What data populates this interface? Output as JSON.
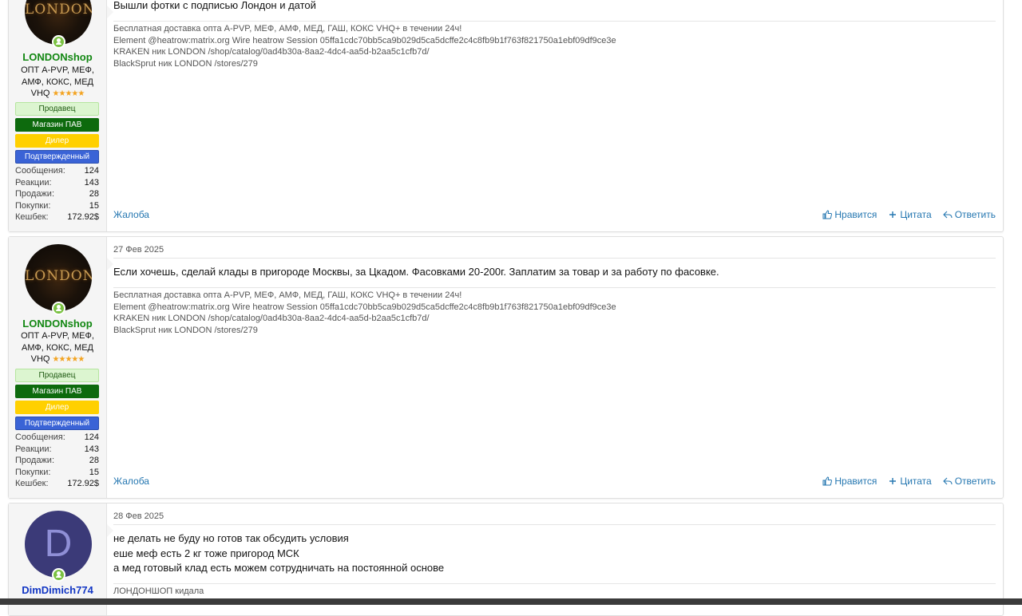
{
  "posts": [
    {
      "user": {
        "avatar_text": "LONDON",
        "name": "LONDONshop",
        "title": "ОПТ A-PVP, МЕФ, АМФ, КОКС, МЕД VHQ",
        "stars": "★★★★★",
        "banners": {
          "seller": "Продавец",
          "shop": "Магазин ПАВ",
          "dealer": "Дилер",
          "verified": "Подтвержденный"
        },
        "stats": [
          {
            "k": "Сообщения:",
            "v": "124"
          },
          {
            "k": "Реакции:",
            "v": "143"
          },
          {
            "k": "Продажи:",
            "v": "28"
          },
          {
            "k": "Покупки:",
            "v": "15"
          },
          {
            "k": "Кешбек:",
            "v": "172.92$"
          }
        ]
      },
      "message": [
        "Вышли фотки с подписью Лондон и датой"
      ],
      "signature": [
        "Бесплатная доставка опта A-PVP, МЕФ, АМФ, МЕД, ГАШ, КОКС VHQ+ в течении 24ч!",
        "Element @heatrow:matrix.org Wire heatrow Session 05ffa1cdc70bb5ca9b029d5ca5dcffe2c4c8fb9b1f763f821750a1ebf09df9ce3e",
        "KRAKEN ник LONDON /shop/catalog/0ad4b30a-8aa2-4dc4-aa5d-b2aa5c1cfb7d/",
        "BlackSprut ник LONDON /stores/279"
      ],
      "report": "Жалоба",
      "actions": {
        "like": "Нравится",
        "quote": "Цитата",
        "reply": "Ответить"
      }
    },
    {
      "date": "27 Фев 2025",
      "user": {
        "avatar_text": "LONDON",
        "name": "LONDONshop",
        "title": "ОПТ A-PVP, МЕФ, АМФ, КОКС, МЕД VHQ",
        "stars": "★★★★★",
        "banners": {
          "seller": "Продавец",
          "shop": "Магазин ПАВ",
          "dealer": "Дилер",
          "verified": "Подтвержденный"
        },
        "stats": [
          {
            "k": "Сообщения:",
            "v": "124"
          },
          {
            "k": "Реакции:",
            "v": "143"
          },
          {
            "k": "Продажи:",
            "v": "28"
          },
          {
            "k": "Покупки:",
            "v": "15"
          },
          {
            "k": "Кешбек:",
            "v": "172.92$"
          }
        ]
      },
      "message": [
        "Если хочешь, сделай клады в пригороде Москвы, за Цкадом. Фасовками 20-200г. Заплатим за товар и за работу по фасовке."
      ],
      "signature": [
        "Бесплатная доставка опта A-PVP, МЕФ, АМФ, МЕД, ГАШ, КОКС VHQ+ в течении 24ч!",
        "Element @heatrow:matrix.org Wire heatrow Session 05ffa1cdc70bb5ca9b029d5ca5dcffe2c4c8fb9b1f763f821750a1ebf09df9ce3e",
        "KRAKEN ник LONDON /shop/catalog/0ad4b30a-8aa2-4dc4-aa5d-b2aa5c1cfb7d/",
        "BlackSprut ник LONDON /stores/279"
      ],
      "report": "Жалоба",
      "actions": {
        "like": "Нравится",
        "quote": "Цитата",
        "reply": "Ответить"
      }
    },
    {
      "date": "28 Фев 2025",
      "user": {
        "avatar_letter": "D",
        "name": "DimDimich774"
      },
      "message": [
        "не делать не буду но готов так обсудить условия",
        "еше меф есть 2 кг тоже пригород МСК",
        "а мед готовый клад есть можем сотрудничать на постоянной основе"
      ],
      "signature": [
        "ЛОНДОНШОП кидала"
      ]
    }
  ]
}
